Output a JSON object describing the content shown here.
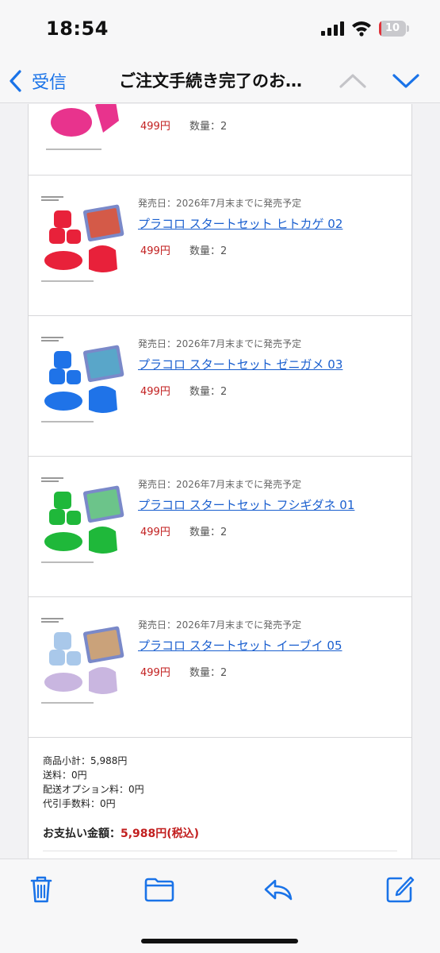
{
  "status": {
    "time": "18:54",
    "battery_level": "10",
    "battery_fraction": 0.1,
    "icons": [
      "signal-icon",
      "wifi-icon",
      "battery-icon"
    ]
  },
  "nav": {
    "back_label": "受信",
    "title": "ご注文手続き完了のお…",
    "icons": [
      "back-chevron-icon",
      "chevron-up-icon",
      "chevron-down-icon"
    ]
  },
  "order": {
    "items": [
      {
        "release_date": "",
        "name": "",
        "price": "499円",
        "quantity": "数量：2",
        "color": "#e8338d"
      },
      {
        "release_date": "発売日：2026年7月末までに発売予定",
        "name": "プラコロ スタートセット ヒトカゲ 02",
        "price": "499円",
        "quantity": "数量：2",
        "color": "#e8213a"
      },
      {
        "release_date": "発売日：2026年7月末までに発売予定",
        "name": "プラコロ スタートセット ゼニガメ 03",
        "price": "499円",
        "quantity": "数量：2",
        "color": "#1f73e8"
      },
      {
        "release_date": "発売日：2026年7月末までに発売予定",
        "name": "プラコロ スタートセット フシギダネ 01",
        "price": "499円",
        "quantity": "数量：2",
        "color": "#1fb83a"
      },
      {
        "release_date": "発売日：2026年7月末までに発売予定",
        "name": "プラコロ スタートセット イーブイ 05",
        "price": "499円",
        "quantity": "数量：2",
        "color": "#c9b6e0"
      }
    ],
    "summary": {
      "subtotal": "商品小計：5,988円",
      "shipping": "送料：0円",
      "delivery_option": "配送オプション料：0円",
      "cod_fee": "代引手数料：0円",
      "total_label": "お支払い金額：",
      "total_amount": "5,988円(税込)"
    }
  },
  "toolbar": {
    "icons": [
      "trash-icon",
      "folder-icon",
      "reply-icon",
      "compose-icon"
    ]
  },
  "colors": {
    "accent": "#1a73e8",
    "price": "#c21f1f",
    "link": "#1a5fcf"
  }
}
